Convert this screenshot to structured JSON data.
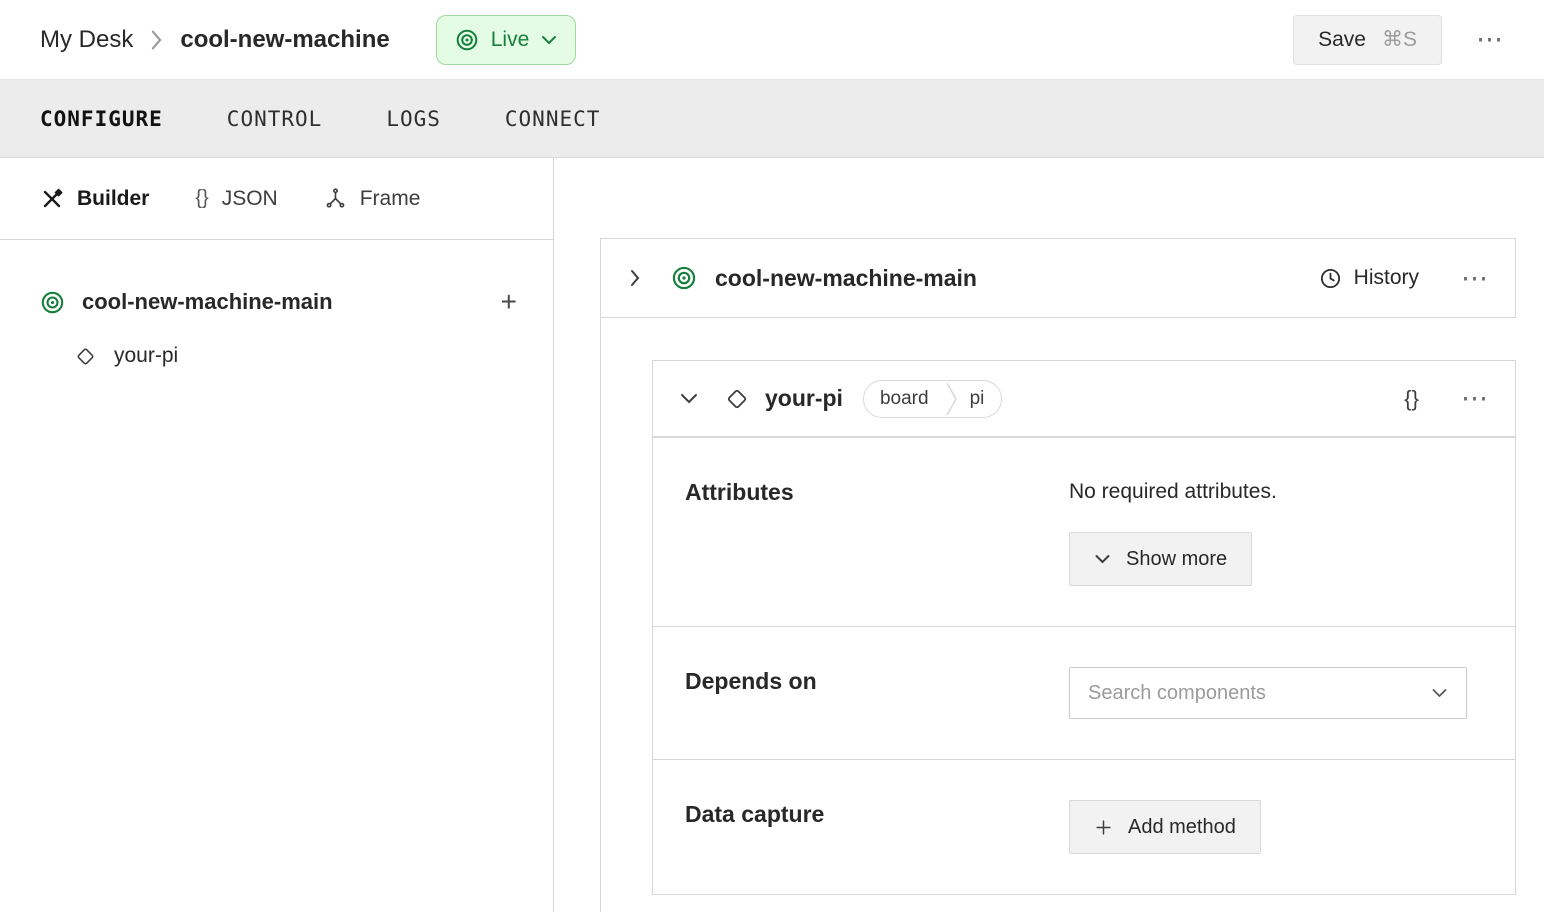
{
  "header": {
    "breadcrumb_root": "My Desk",
    "breadcrumb_current": "cool-new-machine",
    "live_label": "Live",
    "save_label": "Save",
    "save_shortcut": "⌘S",
    "more": "⋯"
  },
  "tabs": {
    "configure": "CONFIGURE",
    "control": "CONTROL",
    "logs": "LOGS",
    "connect": "CONNECT"
  },
  "sidebar": {
    "builder_label": "Builder",
    "json_icon": "{}",
    "json_label": "JSON",
    "frame_label": "Frame",
    "root_label": "cool-new-machine-main",
    "add_button": "+",
    "child_label": "your-pi"
  },
  "main": {
    "machine_title": "cool-new-machine-main",
    "history_label": "History",
    "machine_more": "⋯",
    "component": {
      "title": "your-pi",
      "badge_type": "board",
      "badge_model": "pi",
      "json_icon": "{}",
      "more": "⋯",
      "attributes_label": "Attributes",
      "attributes_text": "No required attributes.",
      "show_more_label": "Show more",
      "depends_label": "Depends on",
      "depends_placeholder": "Search components",
      "capture_label": "Data capture",
      "add_method_label": "Add method"
    }
  },
  "colors": {
    "accent_green": "#157f3c",
    "live_badge_bg": "#e4fbe4",
    "live_badge_border": "#9fd8a0",
    "tabbar_bg": "#ececec",
    "card_border": "#d7d7d7",
    "button_bg": "#f2f2f2",
    "text_primary": "#282829",
    "text_muted": "#9b9b9b"
  }
}
